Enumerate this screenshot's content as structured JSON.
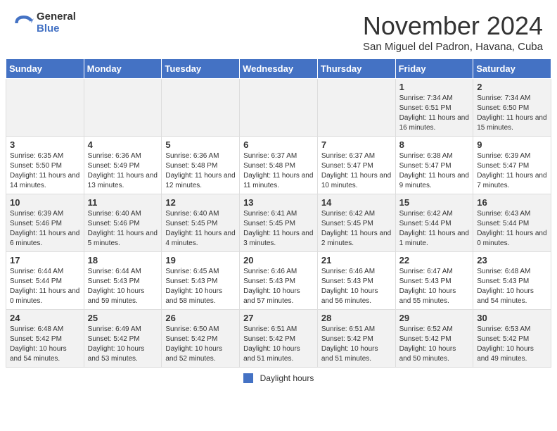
{
  "header": {
    "logo_general": "General",
    "logo_blue": "Blue",
    "month_title": "November 2024",
    "subtitle": "San Miguel del Padron, Havana, Cuba"
  },
  "weekdays": [
    "Sunday",
    "Monday",
    "Tuesday",
    "Wednesday",
    "Thursday",
    "Friday",
    "Saturday"
  ],
  "weeks": [
    [
      {
        "day": "",
        "info": ""
      },
      {
        "day": "",
        "info": ""
      },
      {
        "day": "",
        "info": ""
      },
      {
        "day": "",
        "info": ""
      },
      {
        "day": "",
        "info": ""
      },
      {
        "day": "1",
        "info": "Sunrise: 7:34 AM\nSunset: 6:51 PM\nDaylight: 11 hours and 16 minutes."
      },
      {
        "day": "2",
        "info": "Sunrise: 7:34 AM\nSunset: 6:50 PM\nDaylight: 11 hours and 15 minutes."
      }
    ],
    [
      {
        "day": "3",
        "info": "Sunrise: 6:35 AM\nSunset: 5:50 PM\nDaylight: 11 hours and 14 minutes."
      },
      {
        "day": "4",
        "info": "Sunrise: 6:36 AM\nSunset: 5:49 PM\nDaylight: 11 hours and 13 minutes."
      },
      {
        "day": "5",
        "info": "Sunrise: 6:36 AM\nSunset: 5:48 PM\nDaylight: 11 hours and 12 minutes."
      },
      {
        "day": "6",
        "info": "Sunrise: 6:37 AM\nSunset: 5:48 PM\nDaylight: 11 hours and 11 minutes."
      },
      {
        "day": "7",
        "info": "Sunrise: 6:37 AM\nSunset: 5:47 PM\nDaylight: 11 hours and 10 minutes."
      },
      {
        "day": "8",
        "info": "Sunrise: 6:38 AM\nSunset: 5:47 PM\nDaylight: 11 hours and 9 minutes."
      },
      {
        "day": "9",
        "info": "Sunrise: 6:39 AM\nSunset: 5:47 PM\nDaylight: 11 hours and 7 minutes."
      }
    ],
    [
      {
        "day": "10",
        "info": "Sunrise: 6:39 AM\nSunset: 5:46 PM\nDaylight: 11 hours and 6 minutes."
      },
      {
        "day": "11",
        "info": "Sunrise: 6:40 AM\nSunset: 5:46 PM\nDaylight: 11 hours and 5 minutes."
      },
      {
        "day": "12",
        "info": "Sunrise: 6:40 AM\nSunset: 5:45 PM\nDaylight: 11 hours and 4 minutes."
      },
      {
        "day": "13",
        "info": "Sunrise: 6:41 AM\nSunset: 5:45 PM\nDaylight: 11 hours and 3 minutes."
      },
      {
        "day": "14",
        "info": "Sunrise: 6:42 AM\nSunset: 5:45 PM\nDaylight: 11 hours and 2 minutes."
      },
      {
        "day": "15",
        "info": "Sunrise: 6:42 AM\nSunset: 5:44 PM\nDaylight: 11 hours and 1 minute."
      },
      {
        "day": "16",
        "info": "Sunrise: 6:43 AM\nSunset: 5:44 PM\nDaylight: 11 hours and 0 minutes."
      }
    ],
    [
      {
        "day": "17",
        "info": "Sunrise: 6:44 AM\nSunset: 5:44 PM\nDaylight: 11 hours and 0 minutes."
      },
      {
        "day": "18",
        "info": "Sunrise: 6:44 AM\nSunset: 5:43 PM\nDaylight: 10 hours and 59 minutes."
      },
      {
        "day": "19",
        "info": "Sunrise: 6:45 AM\nSunset: 5:43 PM\nDaylight: 10 hours and 58 minutes."
      },
      {
        "day": "20",
        "info": "Sunrise: 6:46 AM\nSunset: 5:43 PM\nDaylight: 10 hours and 57 minutes."
      },
      {
        "day": "21",
        "info": "Sunrise: 6:46 AM\nSunset: 5:43 PM\nDaylight: 10 hours and 56 minutes."
      },
      {
        "day": "22",
        "info": "Sunrise: 6:47 AM\nSunset: 5:43 PM\nDaylight: 10 hours and 55 minutes."
      },
      {
        "day": "23",
        "info": "Sunrise: 6:48 AM\nSunset: 5:43 PM\nDaylight: 10 hours and 54 minutes."
      }
    ],
    [
      {
        "day": "24",
        "info": "Sunrise: 6:48 AM\nSunset: 5:42 PM\nDaylight: 10 hours and 54 minutes."
      },
      {
        "day": "25",
        "info": "Sunrise: 6:49 AM\nSunset: 5:42 PM\nDaylight: 10 hours and 53 minutes."
      },
      {
        "day": "26",
        "info": "Sunrise: 6:50 AM\nSunset: 5:42 PM\nDaylight: 10 hours and 52 minutes."
      },
      {
        "day": "27",
        "info": "Sunrise: 6:51 AM\nSunset: 5:42 PM\nDaylight: 10 hours and 51 minutes."
      },
      {
        "day": "28",
        "info": "Sunrise: 6:51 AM\nSunset: 5:42 PM\nDaylight: 10 hours and 51 minutes."
      },
      {
        "day": "29",
        "info": "Sunrise: 6:52 AM\nSunset: 5:42 PM\nDaylight: 10 hours and 50 minutes."
      },
      {
        "day": "30",
        "info": "Sunrise: 6:53 AM\nSunset: 5:42 PM\nDaylight: 10 hours and 49 minutes."
      }
    ]
  ],
  "footer": {
    "legend_label": "Daylight hours"
  }
}
